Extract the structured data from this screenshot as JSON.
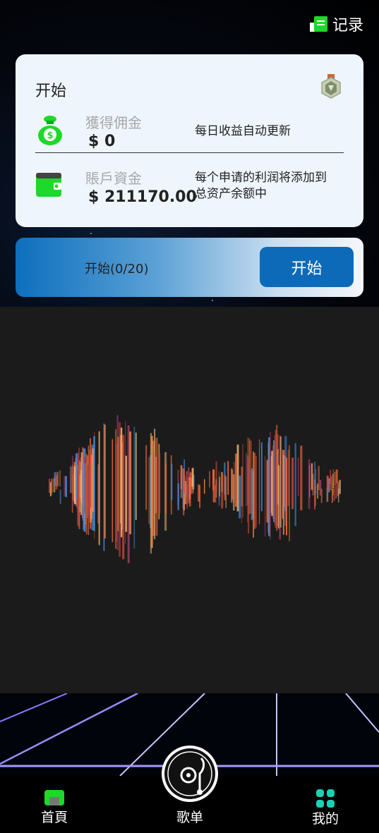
{
  "header": {
    "record_label": "记录",
    "record_icon": "ledger-icon"
  },
  "card": {
    "title": "开始",
    "badge_icon": "rank-badge-icon",
    "commission": {
      "label": "獲得佣金",
      "value": "$ 0",
      "desc": "每日收益自动更新",
      "icon": "money-bag-icon"
    },
    "account": {
      "label": "賬戶資金",
      "value": "$ 211170.00",
      "desc_line1": "每个申请的利润将添加到",
      "desc_line2": "总资产余额中",
      "icon": "wallet-icon"
    }
  },
  "start_bar": {
    "label": "开始(0/20)",
    "button_label": "开始"
  },
  "tabbar": {
    "home": {
      "label": "首頁",
      "icon": "home-icon"
    },
    "playlist": {
      "label": "歌单",
      "icon": "music-disc-icon"
    },
    "mine": {
      "label": "我的",
      "icon": "grid-apps-icon"
    }
  },
  "colors": {
    "accent": "#0c6ab8",
    "green": "#1ed82a",
    "teal": "#17d3b4"
  }
}
